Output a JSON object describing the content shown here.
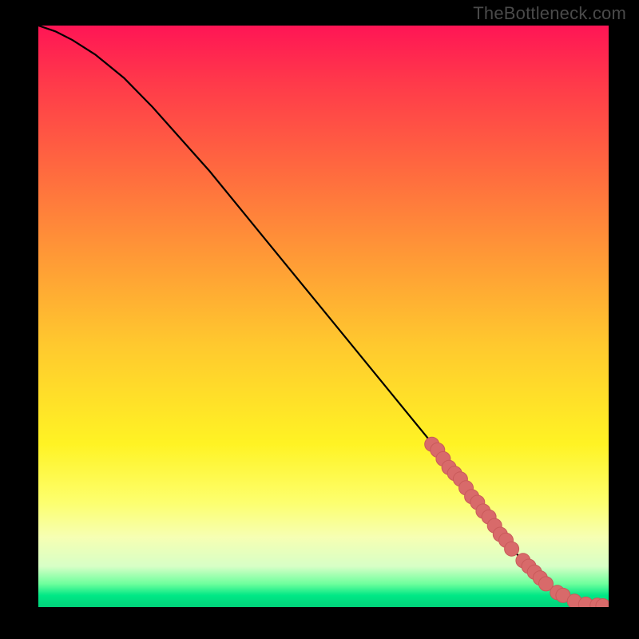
{
  "watermark": "TheBottleneck.com",
  "colors": {
    "dot_fill": "#d86a6a",
    "dot_stroke": "#c95a5a",
    "curve": "#000000",
    "frame": "#000000"
  },
  "chart_data": {
    "type": "line",
    "title": "",
    "xlabel": "",
    "ylabel": "",
    "xlim": [
      0,
      100
    ],
    "ylim": [
      0,
      100
    ],
    "grid": false,
    "legend": false,
    "series": [
      {
        "name": "bottleneck-curve",
        "x": [
          0,
          3,
          6,
          10,
          15,
          20,
          30,
          40,
          50,
          60,
          70,
          76,
          80,
          82,
          84,
          86,
          88,
          90,
          92,
          94,
          96,
          98,
          100
        ],
        "y": [
          100,
          99,
          97.5,
          95,
          91,
          86,
          75,
          63,
          51,
          39,
          27,
          19,
          14,
          11.5,
          9,
          7,
          5,
          3.5,
          2.2,
          1.2,
          0.6,
          0.3,
          0.2
        ]
      }
    ],
    "highlight_points": {
      "name": "highlighted-segment",
      "x": [
        69,
        70,
        71,
        72,
        73,
        74,
        75,
        76,
        77,
        78,
        79,
        80,
        81,
        82,
        83,
        85,
        86,
        87,
        88,
        89,
        91,
        92,
        94,
        96,
        98,
        99
      ],
      "y": [
        28,
        27,
        25.5,
        24,
        23,
        22,
        20.5,
        19,
        18,
        16.5,
        15.5,
        14,
        12.5,
        11.5,
        10,
        8,
        7,
        6,
        5,
        4,
        2.5,
        2,
        1,
        0.5,
        0.3,
        0.2
      ]
    }
  }
}
